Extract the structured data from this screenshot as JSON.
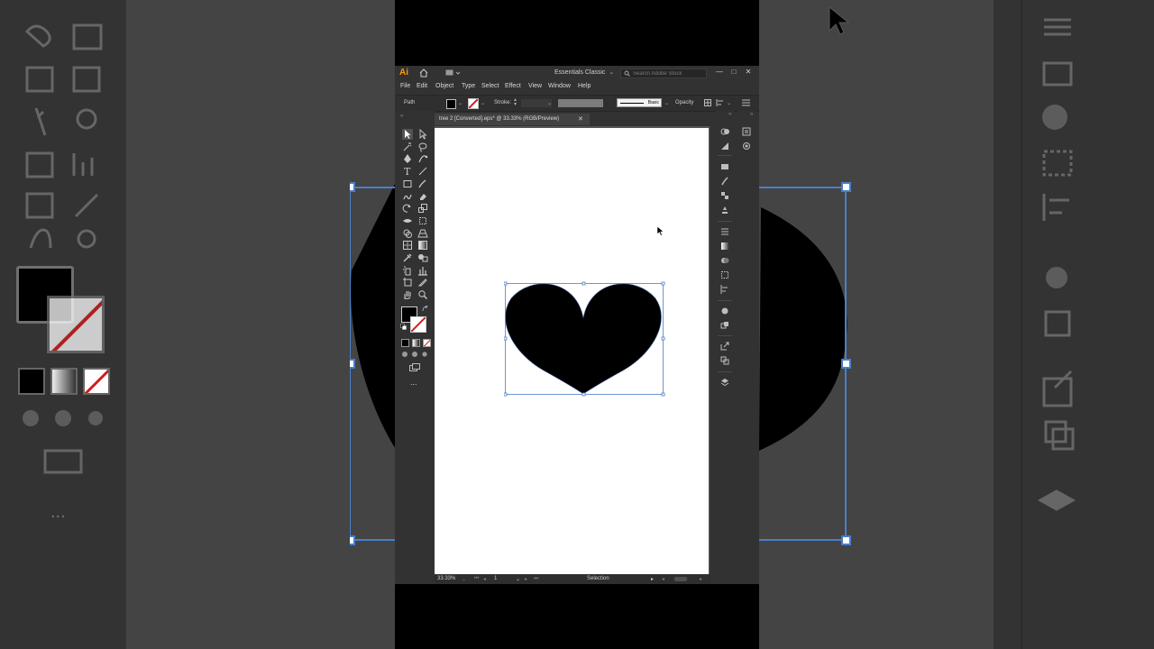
{
  "app": {
    "logo": "Ai",
    "workspace": "Essentials Classic",
    "search_placeholder": "Search Adobe Stock",
    "window_controls": [
      "—",
      "□",
      "✕"
    ]
  },
  "menu": [
    "File",
    "Edit",
    "Object",
    "Type",
    "Select",
    "Effect",
    "View",
    "Window",
    "Help"
  ],
  "control_bar": {
    "selection_type": "Path",
    "stroke_label": "Stroke:",
    "stroke_style": "Basic",
    "opacity_label": "Opacity"
  },
  "document": {
    "tab_title": "tree 2 [Converted].eps* @ 33.33% (RGB/Preview)",
    "close": "✕"
  },
  "statusbar": {
    "zoom": "33.33%",
    "page": "1",
    "mode": "Selection"
  },
  "tools": {
    "more_label": "..."
  },
  "colors": {
    "fill": "#000000",
    "stroke_none": "#d21d1d",
    "accent": "#ff9a00",
    "selection": "#4a7ec9"
  }
}
